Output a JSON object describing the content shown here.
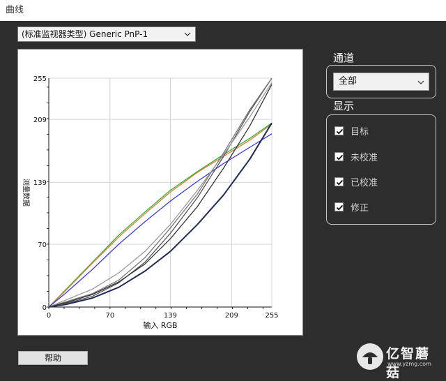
{
  "window": {
    "title": "曲线"
  },
  "profile": {
    "selected": "(标准监视器类型) Generic PnP-1"
  },
  "channel": {
    "label": "通道",
    "selected": "全部"
  },
  "display": {
    "label": "显示",
    "options": [
      {
        "label": "目标",
        "checked": true
      },
      {
        "label": "未校准",
        "checked": true
      },
      {
        "label": "已校准",
        "checked": true
      },
      {
        "label": "修正",
        "checked": true
      }
    ]
  },
  "help_button": {
    "label": "帮助"
  },
  "logo": {
    "name": "亿智蘑菇",
    "url": "www.yzmg.com"
  },
  "chart_data": {
    "type": "line",
    "xlabel": "输入 RGB",
    "ylabel": "测量数据",
    "xlim": [
      0,
      255
    ],
    "ylim": [
      0,
      255
    ],
    "xticks": [
      "0",
      "70",
      "139",
      "209",
      "255"
    ],
    "yticks": [
      "0",
      "70",
      "139",
      "209",
      "255"
    ],
    "xtick_values": [
      0,
      70,
      139,
      209,
      255
    ],
    "ytick_values": [
      0,
      70,
      139,
      209,
      255
    ],
    "grid": true,
    "series": [
      {
        "color": "#2db52d",
        "x": [
          0,
          20,
          50,
          80,
          110,
          139,
          170,
          200,
          230,
          255
        ],
        "y": [
          0,
          20,
          50,
          80,
          106,
          130,
          151,
          170,
          188,
          205
        ]
      },
      {
        "color": "#e07a3a",
        "x": [
          0,
          20,
          50,
          80,
          110,
          139,
          170,
          200,
          230,
          255
        ],
        "y": [
          0,
          19,
          49,
          78,
          104,
          128,
          150,
          168,
          186,
          204
        ]
      },
      {
        "color": "#3a3ae0",
        "x": [
          0,
          20,
          50,
          80,
          110,
          139,
          170,
          200,
          230,
          255
        ],
        "y": [
          0,
          16,
          42,
          70,
          95,
          118,
          140,
          160,
          178,
          193
        ]
      },
      {
        "color": "#1e2a5a",
        "x": [
          0,
          20,
          50,
          80,
          110,
          139,
          170,
          200,
          230,
          255
        ],
        "y": [
          0,
          3,
          10,
          22,
          40,
          62,
          92,
          125,
          165,
          205
        ]
      },
      {
        "color": "#555555",
        "x": [
          0,
          20,
          50,
          80,
          110,
          139,
          170,
          200,
          230,
          255
        ],
        "y": [
          0,
          4,
          12,
          27,
          50,
          82,
          122,
          168,
          218,
          255
        ]
      },
      {
        "color": "#777777",
        "x": [
          0,
          20,
          50,
          80,
          110,
          139,
          170,
          200,
          230,
          255
        ],
        "y": [
          0,
          6,
          15,
          30,
          55,
          88,
          126,
          172,
          220,
          255
        ]
      },
      {
        "color": "#999999",
        "x": [
          0,
          20,
          50,
          80,
          110,
          139,
          170,
          200,
          230,
          255
        ],
        "y": [
          0,
          8,
          20,
          38,
          62,
          92,
          130,
          170,
          212,
          250
        ]
      },
      {
        "color": "#333333",
        "x": [
          0,
          20,
          50,
          80,
          110,
          139,
          170,
          200,
          230,
          255
        ],
        "y": [
          0,
          5,
          14,
          28,
          48,
          76,
          112,
          155,
          202,
          248
        ]
      }
    ]
  }
}
